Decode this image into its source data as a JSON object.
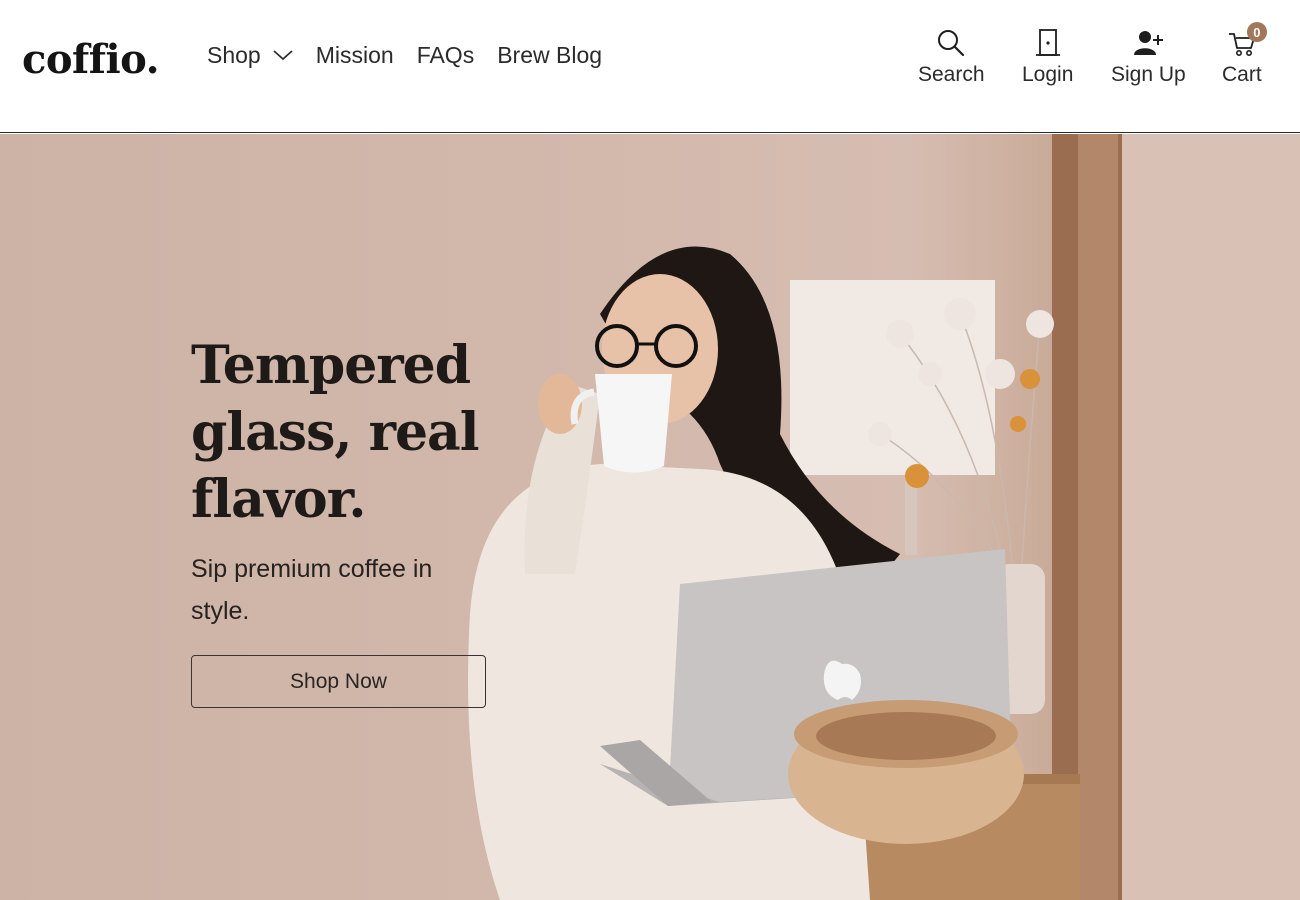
{
  "brand": {
    "logo": "coffio."
  },
  "nav": {
    "shop": "Shop",
    "mission": "Mission",
    "faqs": "FAQs",
    "brew_blog": "Brew Blog"
  },
  "actions": {
    "search": "Search",
    "login": "Login",
    "signup": "Sign Up",
    "cart": "Cart",
    "cart_count": "0"
  },
  "hero": {
    "title": "Tempered glass, real flavor.",
    "subtitle": "Sip premium coffee in style.",
    "cta": "Shop Now"
  },
  "colors": {
    "accent_badge": "#a3785a",
    "hero_background": "#d2b8ab",
    "text_dark": "#1e1a17"
  },
  "icons": {
    "search": "search-icon",
    "login": "door-icon",
    "signup": "user-plus-icon",
    "cart": "cart-icon",
    "shop_menu": "chevron-down-icon"
  }
}
